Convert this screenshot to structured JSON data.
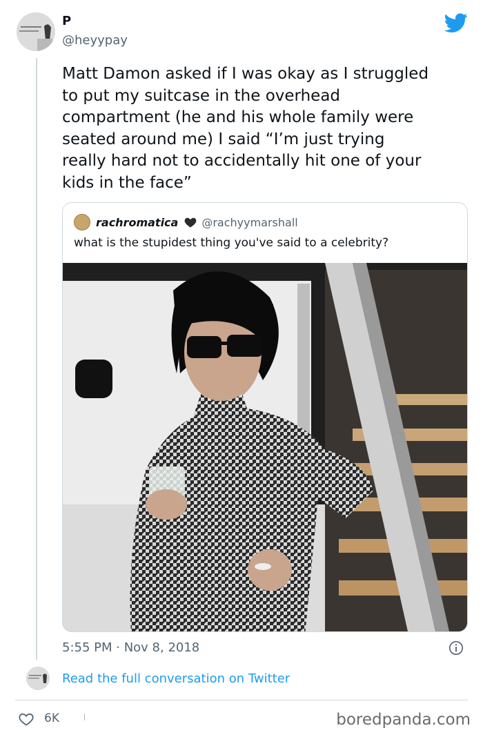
{
  "author": {
    "name": "P",
    "handle": "@heyypay"
  },
  "tweet": {
    "text": "Matt Damon asked if I was okay as I struggled\nto put my suitcase in the overhead\ncompartment (he and his whole family were\nseated around me) I said “I’m just trying\nreally hard not to accidentally hit one of your\nkids in the face”"
  },
  "quote": {
    "name": "rachromatica",
    "handle": "@rachyymarshall",
    "text": "what is the stupidest thing you've said to a celebrity?"
  },
  "meta": {
    "timestamp": "5:55 PM · Nov 8, 2018"
  },
  "footer": {
    "read_link": "Read the full conversation on Twitter",
    "like_count": "6K",
    "watermark": "boredpanda.com"
  },
  "colors": {
    "accent": "#1d9bf0",
    "muted": "#536471",
    "border": "#cfd9de"
  },
  "icons": [
    "twitter-bird-icon",
    "heart-badge-icon",
    "info-icon",
    "heart-outline-icon"
  ]
}
